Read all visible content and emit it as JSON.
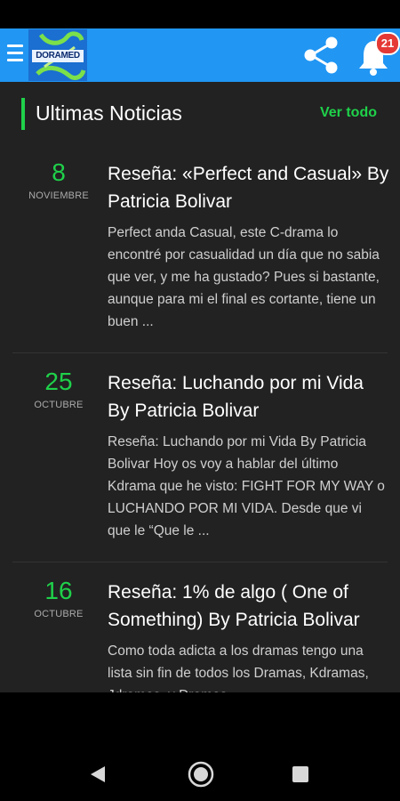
{
  "app": {
    "logo_text": "DORAMED"
  },
  "header": {
    "notification_count": "21"
  },
  "section": {
    "title": "Ultimas Noticias",
    "view_all": "Ver todo"
  },
  "news": [
    {
      "day": "8",
      "month": "NOVIEMBRE",
      "title": "Reseña: «Perfect and Casual» By Patricia Bolivar",
      "excerpt": "Perfect anda Casual, este C-drama lo encontré por casualidad un día que no sabia que ver, y me ha gustado? Pues si bastante, aunque para mi el final es cortante, tiene un buen ..."
    },
    {
      "day": "25",
      "month": "OCTUBRE",
      "title": "Reseña: Luchando por mi Vida By Patricia Bolivar",
      "excerpt": "Reseña: Luchando por mi Vida By Patricia Bolivar Hoy os voy a hablar del último Kdrama que he visto: FIGHT FOR MY WAY o LUCHANDO POR MI VIDA. Desde que vi que le “Que le ..."
    },
    {
      "day": "16",
      "month": "OCTUBRE",
      "title": "Reseña: 1% de algo ( One of Something) By Patricia Bolivar",
      "excerpt": "Como toda adicta a los dramas tengo una lista sin fin de todos los Dramas, Kdramas, Jdramas, y Dramas"
    }
  ],
  "colors": {
    "accent": "#1fd14a",
    "app_bar": "#2196f3",
    "badge": "#e53935",
    "background": "#222222"
  },
  "icons": [
    "menu-icon",
    "share-icon",
    "bell-icon",
    "nav-back-icon",
    "nav-home-icon",
    "nav-recent-icon"
  ]
}
